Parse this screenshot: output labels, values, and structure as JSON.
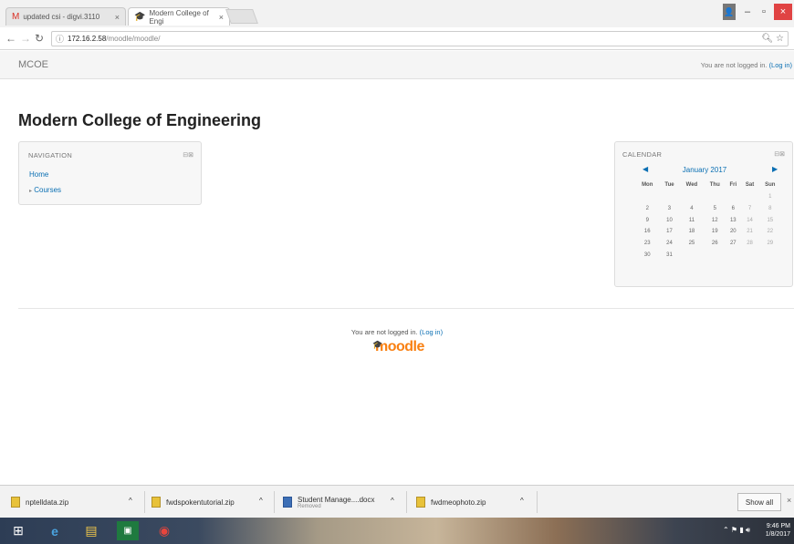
{
  "browser": {
    "tabs": [
      {
        "title": "updated csi - digvi.3110",
        "icon": "gmail-icon"
      },
      {
        "title": "Modern College of Engi",
        "icon": "moodle-favicon"
      }
    ],
    "url_host": "172.16.2.58",
    "url_path": "/moodle/moodle/"
  },
  "header": {
    "brand": "MCOE",
    "login_text": "You are not logged in.",
    "login_link": "(Log in)"
  },
  "page": {
    "title": "Modern College of Engineering"
  },
  "navigation": {
    "heading": "NAVIGATION",
    "home": "Home",
    "courses": "Courses"
  },
  "calendar": {
    "heading": "CALENDAR",
    "month": "January 2017",
    "weekdays": [
      "Mon",
      "Tue",
      "Wed",
      "Thu",
      "Fri",
      "Sat",
      "Sun"
    ],
    "weeks": [
      [
        "",
        "",
        "",
        "",
        "",
        "",
        "1"
      ],
      [
        "2",
        "3",
        "4",
        "5",
        "6",
        "7",
        "8"
      ],
      [
        "9",
        "10",
        "11",
        "12",
        "13",
        "14",
        "15"
      ],
      [
        "16",
        "17",
        "18",
        "19",
        "20",
        "21",
        "22"
      ],
      [
        "23",
        "24",
        "25",
        "26",
        "27",
        "28",
        "29"
      ],
      [
        "30",
        "31",
        "",
        "",
        "",
        "",
        ""
      ]
    ]
  },
  "footer": {
    "login_text": "You are not logged in.",
    "login_link": "(Log in)",
    "logo": "moodle"
  },
  "downloads": {
    "items": [
      {
        "name": "nptelldata.zip",
        "status": ""
      },
      {
        "name": "fwdspokentutorial.zip",
        "status": ""
      },
      {
        "name": "Student Manage....docx",
        "status": "Removed"
      },
      {
        "name": "fwdmeophoto.zip",
        "status": ""
      }
    ],
    "show_all": "Show all"
  },
  "taskbar": {
    "time": "9:46 PM",
    "date": "1/8/2017"
  }
}
